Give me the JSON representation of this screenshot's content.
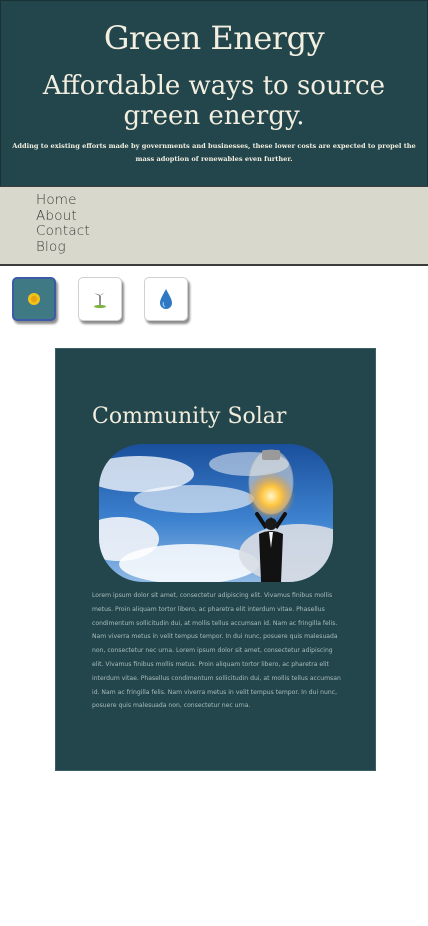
{
  "header": {
    "site_title": "Green Energy",
    "headline": "Affordable ways to source green energy.",
    "intro": "Adding to existing efforts made by governments and businesses, these lower costs are expected to propel the mass adoption of renewables even further."
  },
  "nav": {
    "items": [
      {
        "label": "Home"
      },
      {
        "label": "About"
      },
      {
        "label": "Contact"
      },
      {
        "label": "Blog"
      }
    ]
  },
  "tabs": [
    {
      "icon": "sun-icon",
      "active": true
    },
    {
      "icon": "wind-turbine-icon",
      "active": false
    },
    {
      "icon": "water-drop-icon",
      "active": false
    }
  ],
  "card": {
    "title": "Community Solar",
    "image": "lightbulb-sky-image",
    "body": "Lorem ipsum dolor sit amet, consectetur adipiscing elit. Vivamus finibus mollis metus. Proin aliquam tortor libero, ac pharetra elit interdum vitae. Phasellus condimentum sollicitudin dui, at mollis tellus accumsan id. Nam ac fringilla felis. Nam viverra metus in velit tempus tempor. In dui nunc, posuere quis malesuada non, consectetur nec urna. Lorem ipsum dolor sit amet, consectetur adipiscing elit. Vivamus finibus mollis metus. Proin aliquam tortor libero, ac pharetra elit interdum vitae. Phasellus condimentum sollicitudin dui, at mollis tellus accumsan id. Nam ac fringilla felis. Nam viverra metus in velit tempus tempor. In dui nunc, posuere quis malesuada non, consectetur nec urna."
  },
  "colors": {
    "header_bg": "#23464c",
    "nav_bg": "#d9d8cc",
    "card_bg": "#23464c",
    "active_tab": "#3f7a84"
  }
}
